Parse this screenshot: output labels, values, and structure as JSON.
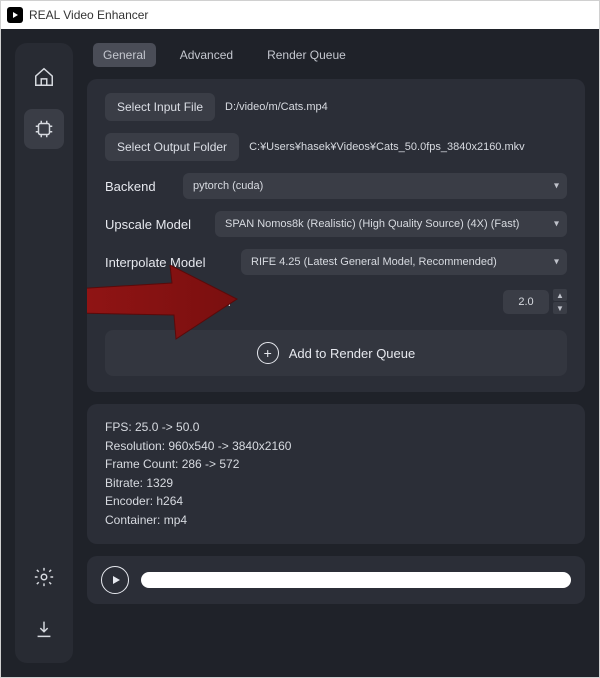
{
  "window": {
    "title": "REAL Video Enhancer"
  },
  "tabs": {
    "general": "General",
    "advanced": "Advanced",
    "render_queue": "Render Queue"
  },
  "buttons": {
    "select_input": "Select Input File",
    "select_output": "Select Output Folder"
  },
  "paths": {
    "input": "D:/video/m/Cats.mp4",
    "output": "C:¥Users¥hasek¥Videos¥Cats_50.0fps_3840x2160.mkv"
  },
  "labels": {
    "backend": "Backend",
    "upscale_model": "Upscale Model",
    "interpolate_model": "Interpolate Model",
    "interpolation_multiplier": "Interpolation Multiplier"
  },
  "selects": {
    "backend": "pytorch (cuda)",
    "upscale_model": "SPAN Nomos8k (Realistic) (High Quality Source) (4X) (Fast)",
    "interpolate_model": "RIFE 4.25 (Latest General Model, Recommended)"
  },
  "multiplier_value": "2.0",
  "add_to_queue": "Add to Render Queue",
  "info": {
    "fps": "FPS: 25.0 -> 50.0",
    "resolution": "Resolution: 960x540 -> 3840x2160",
    "frame_count": "Frame Count: 286 -> 572",
    "bitrate": "Bitrate: 1329",
    "encoder": "Encoder: h264",
    "container": "Container: mp4"
  }
}
